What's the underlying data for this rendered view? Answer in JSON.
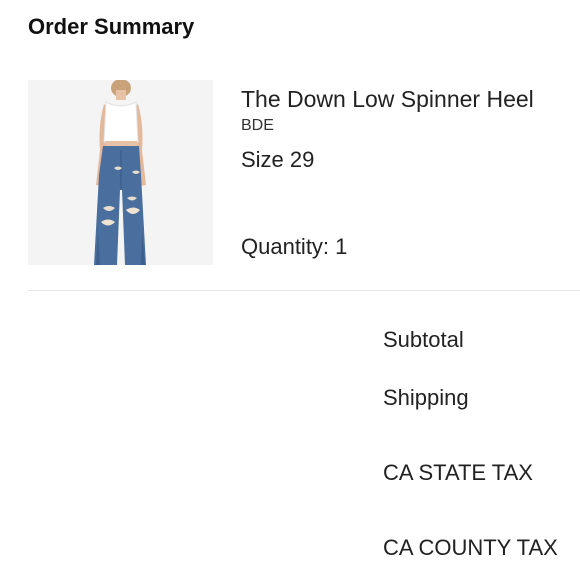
{
  "header": {
    "title": "Order Summary"
  },
  "item": {
    "name": "The Down Low Spinner Heel",
    "brand": "BDE",
    "size": "Size 29",
    "quantity": "Quantity: 1",
    "image_icon": "product-photo-jeans"
  },
  "summary": {
    "subtotal_label": "Subtotal",
    "shipping_label": "Shipping",
    "state_tax_label": "CA STATE TAX",
    "county_tax_label": "CA COUNTY TAX"
  },
  "colors": {
    "image_background": "#f4f4f4",
    "denim": "#4a6f9e",
    "divider": "#e6e6e6"
  }
}
